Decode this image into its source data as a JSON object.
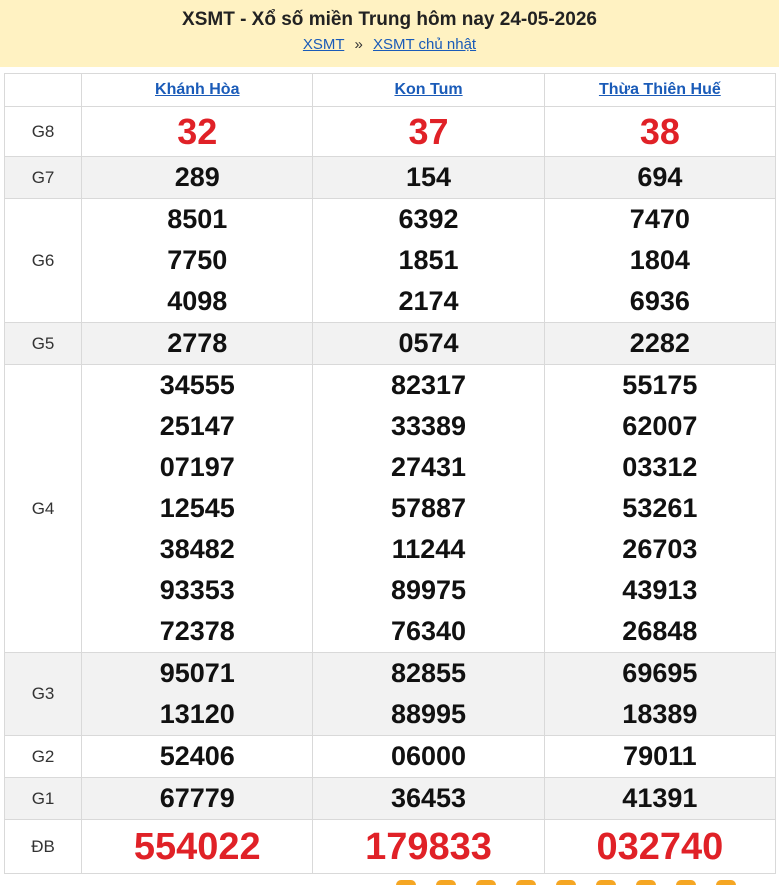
{
  "header": {
    "title": "XSMT - Xổ số miền Trung hôm nay 24-05-2026",
    "crumb_home": "XSMT",
    "crumb_sep": "»",
    "crumb_current": "XSMT chủ nhật",
    "bg_color": "#fff2c2"
  },
  "provinces": [
    "Khánh Hòa",
    "Kon Tum",
    "Thừa Thiên Huế"
  ],
  "prizes": [
    {
      "label": "G8",
      "values": [
        [
          "32"
        ],
        [
          "37"
        ],
        [
          "38"
        ]
      ]
    },
    {
      "label": "G7",
      "values": [
        [
          "289"
        ],
        [
          "154"
        ],
        [
          "694"
        ]
      ]
    },
    {
      "label": "G6",
      "values": [
        [
          "8501",
          "7750",
          "4098"
        ],
        [
          "6392",
          "1851",
          "2174"
        ],
        [
          "7470",
          "1804",
          "6936"
        ]
      ]
    },
    {
      "label": "G5",
      "values": [
        [
          "2778"
        ],
        [
          "0574"
        ],
        [
          "2282"
        ]
      ]
    },
    {
      "label": "G4",
      "values": [
        [
          "34555",
          "25147",
          "07197",
          "12545",
          "38482",
          "93353",
          "72378"
        ],
        [
          "82317",
          "33389",
          "27431",
          "57887",
          "11244",
          "89975",
          "76340"
        ],
        [
          "55175",
          "62007",
          "03312",
          "53261",
          "26703",
          "43913",
          "26848"
        ]
      ]
    },
    {
      "label": "G3",
      "values": [
        [
          "95071",
          "13120"
        ],
        [
          "82855",
          "88995"
        ],
        [
          "69695",
          "18389"
        ]
      ]
    },
    {
      "label": "G2",
      "values": [
        [
          "52406"
        ],
        [
          "06000"
        ],
        [
          "79011"
        ]
      ]
    },
    {
      "label": "G1",
      "values": [
        [
          "67779"
        ],
        [
          "36453"
        ],
        [
          "41391"
        ]
      ]
    },
    {
      "label": "ĐB",
      "values": [
        [
          "554022"
        ],
        [
          "179833"
        ],
        [
          "032740"
        ]
      ]
    }
  ],
  "colors": {
    "special": "#e02127",
    "link": "#1a5bb8",
    "alt_row": "#f2f2f2"
  }
}
